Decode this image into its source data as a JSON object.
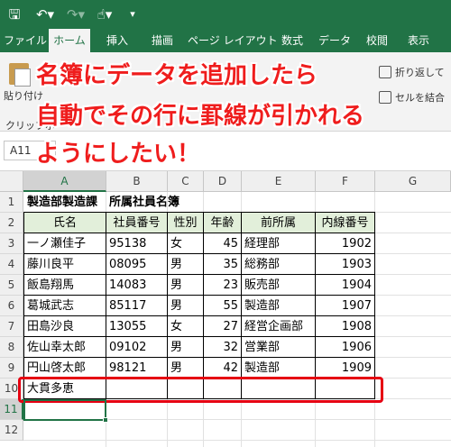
{
  "qat": {
    "save_icon": "save-icon",
    "undo_icon": "undo-icon",
    "redo_icon": "redo-icon",
    "touch_icon": "touch-mode-icon",
    "customize_icon": "customize-qat-icon"
  },
  "tabs": [
    {
      "label": "ファイル"
    },
    {
      "label": "ホーム"
    },
    {
      "label": "挿入"
    },
    {
      "label": "描画"
    },
    {
      "label": "ページ レイアウト"
    },
    {
      "label": "数式"
    },
    {
      "label": "データ"
    },
    {
      "label": "校閲"
    },
    {
      "label": "表示"
    }
  ],
  "ribbon": {
    "paste_label": "貼り付け",
    "clipboard_label": "クリップボ",
    "wrap_text_label": "折り返して",
    "merge_label": "セルを結合"
  },
  "headline": {
    "line1": "名簿にデータを追加したら",
    "line2": "自動でその行に罫線が引かれる",
    "line3": "ようにしたい！"
  },
  "name_box": "A11",
  "columns": [
    "A",
    "B",
    "C",
    "D",
    "E",
    "F",
    "G"
  ],
  "rows": [
    "1",
    "2",
    "3",
    "4",
    "5",
    "6",
    "7",
    "8",
    "9",
    "10",
    "11",
    "12"
  ],
  "sheet": {
    "title": "製造部製造課　所属社員名簿",
    "headers": [
      "氏名",
      "社員番号",
      "性別",
      "年齢",
      "前所属",
      "内線番号"
    ],
    "records": [
      [
        "一ノ瀬佳子",
        "95138",
        "女",
        "45",
        "経理部",
        "1902"
      ],
      [
        "藤川良平",
        "08095",
        "男",
        "35",
        "総務部",
        "1903"
      ],
      [
        "飯島翔馬",
        "14083",
        "男",
        "23",
        "販売部",
        "1904"
      ],
      [
        "葛城武志",
        "85117",
        "男",
        "55",
        "製造部",
        "1907"
      ],
      [
        "田島沙良",
        "13055",
        "女",
        "27",
        "経営企画部",
        "1908"
      ],
      [
        "佐山幸太郎",
        "09102",
        "男",
        "32",
        "営業部",
        "1906"
      ],
      [
        "円山啓太郎",
        "98121",
        "男",
        "42",
        "製造部",
        "1909"
      ]
    ],
    "new_entry": "大貫多恵"
  },
  "colors": {
    "brand": "#217346",
    "header_fill": "#e2efda",
    "highlight": "#e60012",
    "headline": "#ef1d1d"
  }
}
